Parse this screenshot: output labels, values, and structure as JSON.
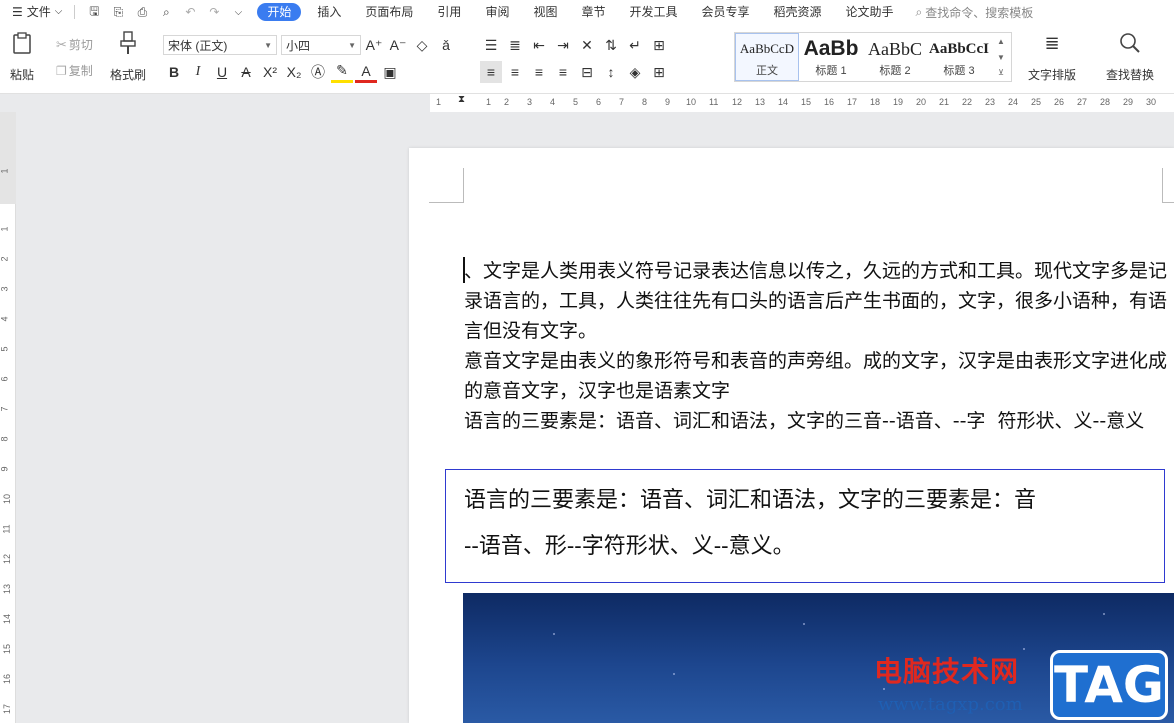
{
  "menubar": {
    "file_label": "文件",
    "tabs": [
      "开始",
      "插入",
      "页面布局",
      "引用",
      "审阅",
      "视图",
      "章节",
      "开发工具",
      "会员专享",
      "稻壳资源",
      "论文助手"
    ],
    "search_label": "查找命令、搜索模板"
  },
  "ribbon": {
    "paste": "粘贴",
    "cut": "剪切",
    "copy": "复制",
    "format_painter": "格式刷",
    "font_name": "宋体 (正文)",
    "font_size": "小四",
    "styles": [
      {
        "preview": "AaBbCcD",
        "label": "正文"
      },
      {
        "preview": "AaBb",
        "label": "标题 1"
      },
      {
        "preview": "AaBbC",
        "label": "标题 2"
      },
      {
        "preview": "AaBbCcI",
        "label": "标题 3"
      }
    ],
    "text_layout": "文字排版",
    "find_replace": "查找替换"
  },
  "ruler": {
    "top_ticks": [
      "1",
      "1",
      "2",
      "3",
      "4",
      "5",
      "6",
      "7",
      "8",
      "9",
      "10",
      "11",
      "12",
      "13",
      "14",
      "15",
      "16",
      "17",
      "18",
      "19",
      "20",
      "21",
      "22",
      "23",
      "24",
      "25",
      "26",
      "27",
      "28",
      "29",
      "30"
    ],
    "left_ticks": [
      "1",
      "1",
      "2",
      "3",
      "4",
      "5",
      "6",
      "7",
      "8",
      "9",
      "10",
      "11",
      "12",
      "13",
      "14",
      "15",
      "16",
      "17"
    ]
  },
  "document": {
    "paragraphs": [
      "、文字是人类用表义符号记录表达信息以传之，久远的方式和工具。现代文字多是记录语言的，工具，人类往往先有口头的语言后产生书面的，文字，很多小语种，有语言但没有文字。",
      "意音文字是由表义的象形符号和表音的声旁组。成的文字，汉字是由表形文字进化成的意音文字，汉字也是语素文字",
      "语言的三要素是：语音、词汇和语法，文字的三音--语音、--字  符形状、义--意义"
    ],
    "textbox_lines": [
      "语言的三要素是：语音、词汇和语法，文字的三要素是：音",
      "--语音、形--字符形状、义--意义。"
    ]
  },
  "watermark": {
    "site_name": "电脑技术网",
    "url": "www.tagxp.com",
    "badge": "TAG"
  },
  "colors": {
    "accent": "#3a7cf0",
    "textbox_border": "#2f3ad0",
    "watermark_red": "#e0281f",
    "watermark_blue": "#1f6fd0"
  }
}
